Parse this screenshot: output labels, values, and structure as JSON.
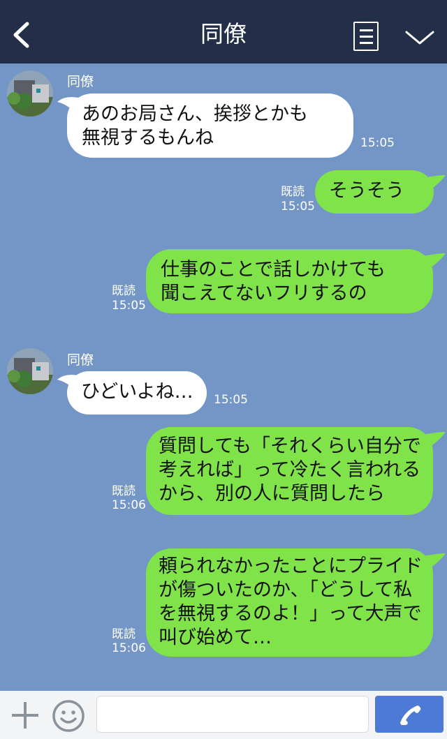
{
  "header": {
    "title": "同僚"
  },
  "colors": {
    "header_bg": "#232f48",
    "chat_bg": "#7396c7",
    "sent_bubble": "#80e34a",
    "received_bubble": "#ffffff",
    "call_button": "#4d7ad6"
  },
  "icons": {
    "back": "chevron-left-icon",
    "menu": "menu-icon",
    "collapse": "chevron-down-icon",
    "add": "plus-icon",
    "emoji": "smiley-icon",
    "call": "phone-icon"
  },
  "messages": [
    {
      "sender": "同僚",
      "text": "あのお局さん、挨拶とかも\n無視するもんね",
      "time": "15:05"
    },
    {
      "text": "そうそう",
      "read": "既読",
      "time": "15:05"
    },
    {
      "text": "仕事のことで話しかけても\n聞こえてないフリするの",
      "read": "既読",
      "time": "15:05"
    },
    {
      "sender": "同僚",
      "text": "ひどいよね…",
      "time": "15:05"
    },
    {
      "text": "質問しても「それくらい自分で\n考えれば」って冷たく言われる\nから、別の人に質問したら",
      "read": "既読",
      "time": "15:06"
    },
    {
      "text": "頼られなかったことにプライド\nが傷ついたのか、「どうして私\nを無視するのよ！」って大声で\n叫び始めて…",
      "read": "既読",
      "time": "15:06"
    }
  ],
  "input": {
    "placeholder": ""
  }
}
